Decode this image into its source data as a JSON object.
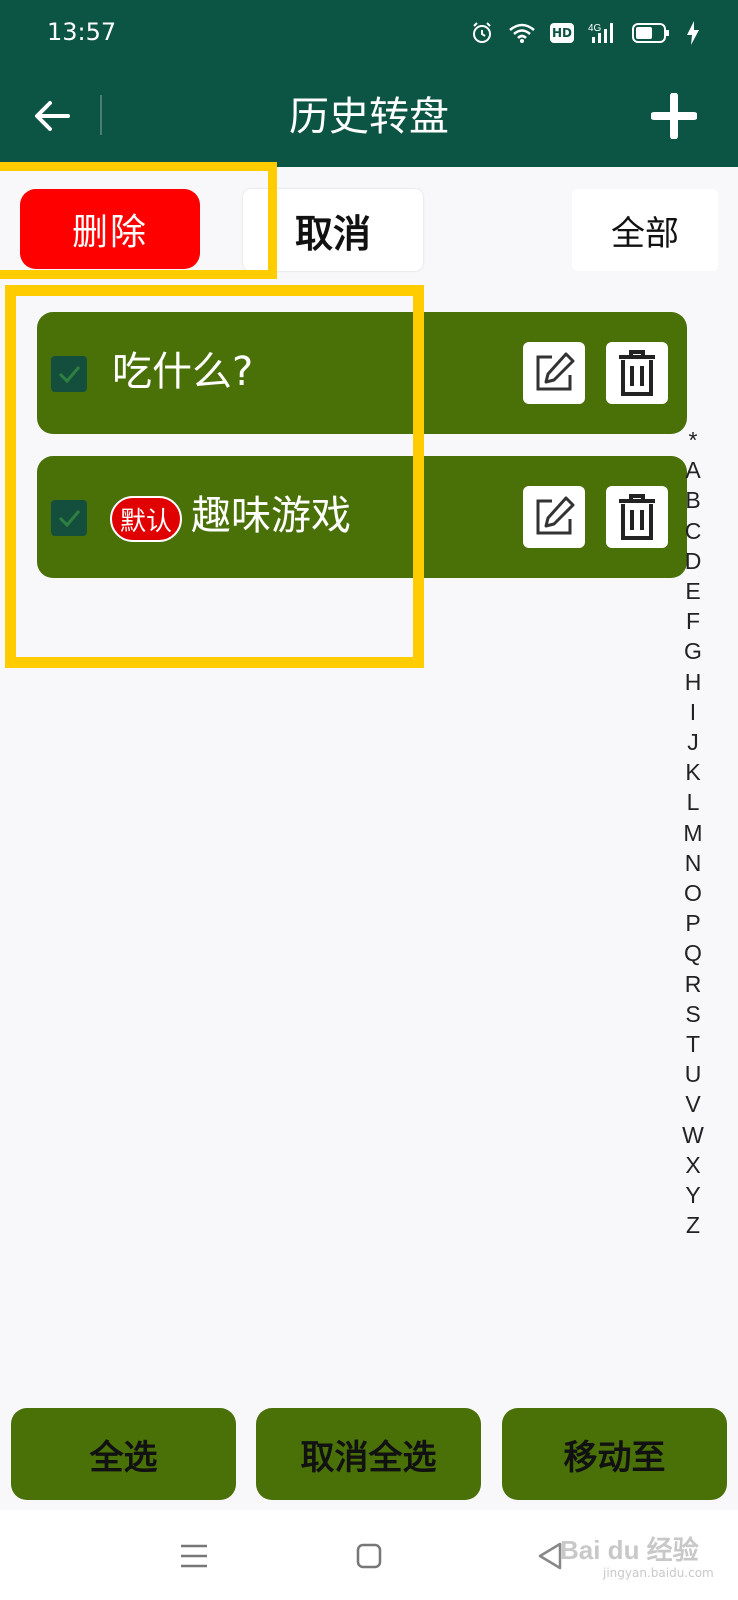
{
  "status_bar": {
    "time": "13:57",
    "icons": [
      "alarm-icon",
      "wifi-icon",
      "hd-icon",
      "signal-4g-icon",
      "battery-icon",
      "charging-icon"
    ],
    "hd_label": "HD",
    "network_label": "4G"
  },
  "app_bar": {
    "title": "历史转盘",
    "back_icon": "arrow-left-icon",
    "add_icon": "plus-icon"
  },
  "actions": {
    "delete_label": "删除",
    "cancel_label": "取消",
    "all_label": "全部"
  },
  "list": {
    "items": [
      {
        "label": "吃什么?",
        "checked": true,
        "is_default": false
      },
      {
        "label": "趣味游戏",
        "checked": true,
        "is_default": true,
        "badge": "默认"
      }
    ]
  },
  "alpha_index": [
    "*",
    "A",
    "B",
    "C",
    "D",
    "E",
    "F",
    "G",
    "H",
    "I",
    "J",
    "K",
    "L",
    "M",
    "N",
    "O",
    "P",
    "Q",
    "R",
    "S",
    "T",
    "U",
    "V",
    "W",
    "X",
    "Y",
    "Z"
  ],
  "bottom_actions": {
    "select_all": "全选",
    "deselect_all": "取消全选",
    "move_to": "移动至"
  },
  "watermark": {
    "brand": "Bai du 经验",
    "url": "jingyan.baidu.com"
  },
  "colors": {
    "header_bg": "#0c5443",
    "delete_red": "#ff0000",
    "item_green": "#4a7008",
    "highlight_yellow": "#ffcc00"
  }
}
